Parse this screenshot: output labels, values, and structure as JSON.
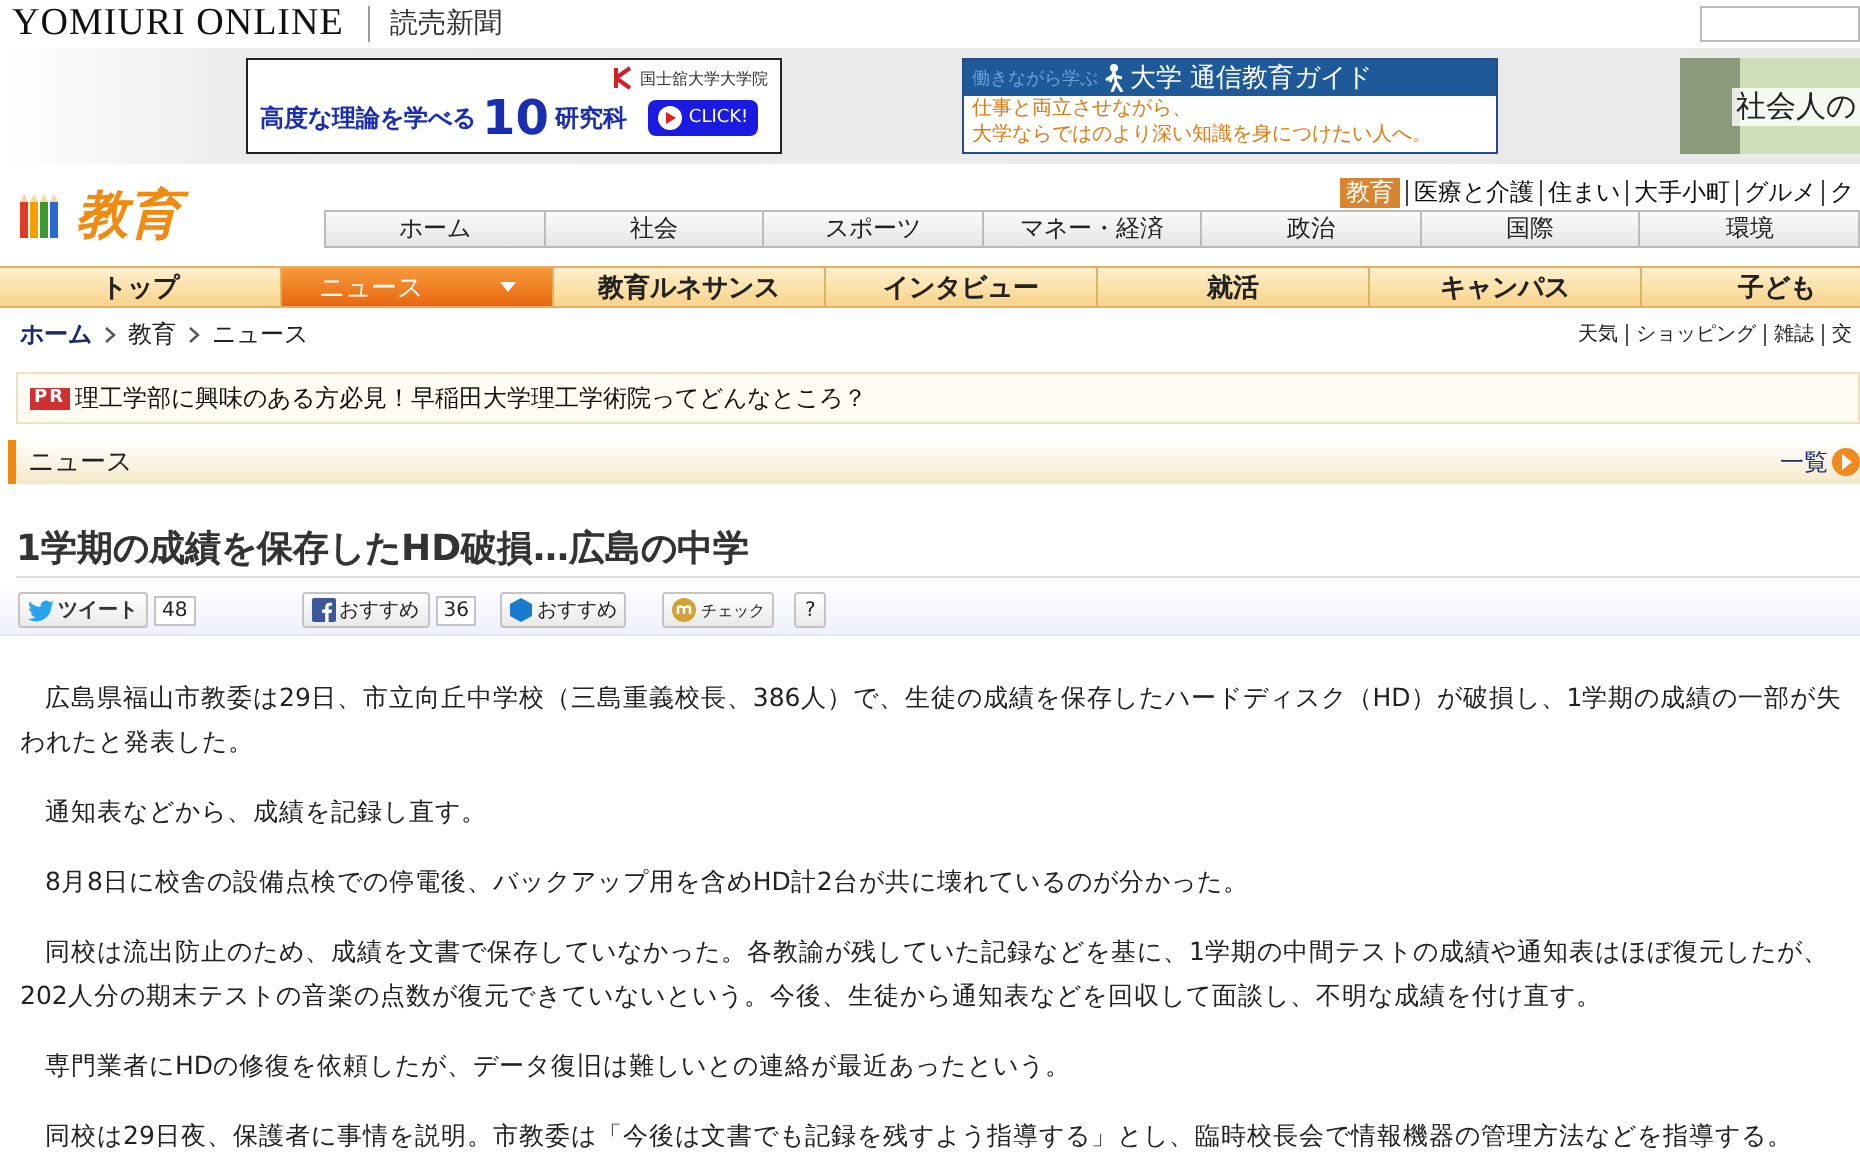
{
  "header": {
    "brand": "YOMIURI ONLINE",
    "paper": "読売新聞"
  },
  "ads": [
    {
      "kind": "graduate",
      "org": "国士舘大学大学院",
      "lead": "高度な理論を学べる",
      "number": "10",
      "unit": "研究科",
      "cta": "CLICK!"
    },
    {
      "kind": "guide",
      "tag": "働きながら学ぶ",
      "title": "大学 通信教育ガイド",
      "line1": "仕事と両立させながら、",
      "line2": "大学ならではのより深い知識を身につけたい人へ。"
    },
    {
      "kind": "photo",
      "title": "社会人の"
    }
  ],
  "section": {
    "logo": "教育",
    "site_links": [
      {
        "label": "教育",
        "selected": true
      },
      {
        "label": "医療と介護",
        "selected": false
      },
      {
        "label": "住まい",
        "selected": false
      },
      {
        "label": "大手小町",
        "selected": false
      },
      {
        "label": "グルメ",
        "selected": false
      },
      {
        "label": "ク",
        "selected": false
      }
    ],
    "global_nav": [
      "ホーム",
      "社会",
      "スポーツ",
      "マネー・経済",
      "政治",
      "国際",
      "環境"
    ],
    "category_nav": [
      {
        "label": "トップ",
        "selected": false
      },
      {
        "label": "ニュース",
        "selected": true
      },
      {
        "label": "教育ルネサンス",
        "selected": false
      },
      {
        "label": "インタビュー",
        "selected": false
      },
      {
        "label": "就活",
        "selected": false
      },
      {
        "label": "キャンパス",
        "selected": false
      },
      {
        "label": "子ども",
        "selected": false
      }
    ],
    "breadcrumb": [
      "ホーム",
      "教育",
      "ニュース"
    ],
    "utility_links": [
      "天気",
      "ショッピング",
      "雑誌",
      "交"
    ]
  },
  "pr": {
    "badge": "PR",
    "text": "理工学部に興味のある方必見！早稲田大学理工学術院ってどんなところ？"
  },
  "section_bar": {
    "title": "ニュース",
    "more": "一覧"
  },
  "article": {
    "headline": "1学期の成績を保存したHD破損…広島の中学",
    "share": [
      {
        "kind": "tweet",
        "label": "ツイート",
        "count": "48"
      },
      {
        "kind": "facebook",
        "label": "おすすめ",
        "count": "36"
      },
      {
        "kind": "hexagon",
        "label": "おすすめ"
      },
      {
        "kind": "check",
        "label": "チェック"
      },
      {
        "kind": "help",
        "label": "?"
      }
    ],
    "paragraphs": [
      "広島県福山市教委は29日、市立向丘中学校（三島重義校長、386人）で、生徒の成績を保存したハードディスク（HD）が破損し、1学期の成績の一部が失われたと発表した。",
      "通知表などから、成績を記録し直す。",
      "8月8日に校舎の設備点検での停電後、バックアップ用を含めHD計2台が共に壊れているのが分かった。",
      "同校は流出防止のため、成績を文書で保存していなかった。各教諭が残していた記録などを基に、1学期の中間テストの成績や通知表はほぼ復元したが、202人分の期末テストの音楽の点数が復元できていないという。今後、生徒から通知表などを回収して面談し、不明な成績を付け直す。",
      "専門業者にHDの修復を依頼したが、データ復旧は難しいとの連絡が最近あったという。",
      "同校は29日夜、保護者に事情を説明。市教委は「今後は文書でも記録を残すよう指導する」とし、臨時校長会で情報機器の管理方法などを指導する。"
    ]
  }
}
